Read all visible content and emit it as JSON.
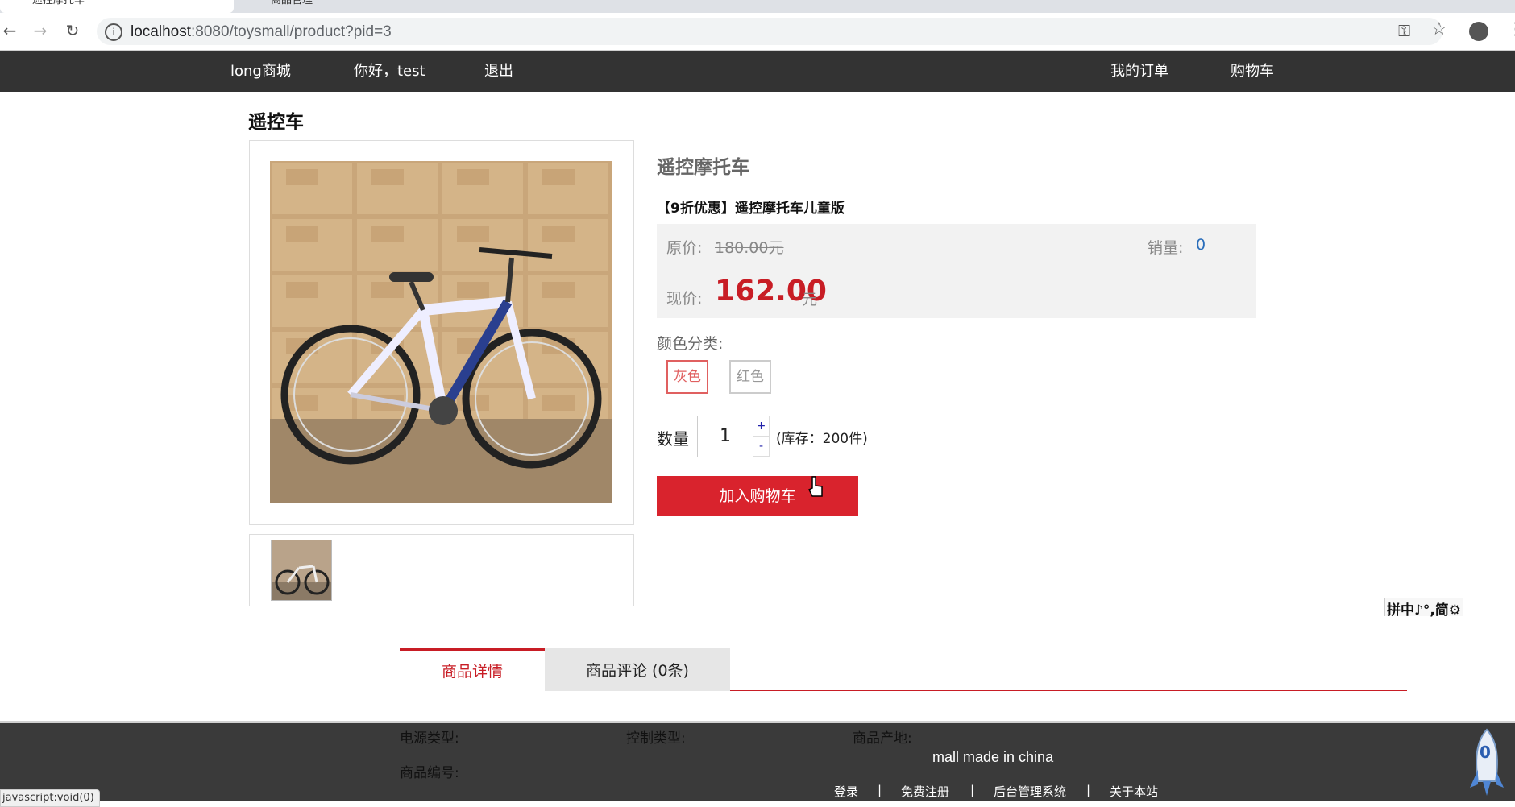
{
  "browser": {
    "tab1_title": "遥控摩托车",
    "tab2_title": "商品管理",
    "url_host": "localhost",
    "url_path": ":8080/toysmall/product?pid=3"
  },
  "header": {
    "brand": "long商城",
    "greeting": "你好，test",
    "logout": "退出",
    "orders": "我的订单",
    "cart": "购物车"
  },
  "category": "遥控车",
  "product": {
    "name": "遥控摩托车",
    "description": "【9折优惠】遥控摩托车儿童版",
    "original_price_label": "原价:",
    "original_price": "180.00元",
    "sales_label": "销量:",
    "sales": "0",
    "now_price_label": "现价:",
    "now_price": "162.00",
    "now_price_unit": "元",
    "color_label": "颜色分类:",
    "colors": [
      "灰色",
      "红色"
    ],
    "quantity_label": "数量",
    "quantity": "1",
    "plus": "+",
    "minus": "-",
    "stock": "(库存：200件)",
    "add_to_cart": "加入购物车"
  },
  "ime": "拼中♪°,简⚙",
  "tabs": {
    "detail": "商品详情",
    "review": "商品评论 (0条)"
  },
  "attributes": {
    "power": "电源类型:",
    "control": "控制类型:",
    "origin": "商品产地:",
    "code": "商品编号:"
  },
  "footer": {
    "tagline": "mall made in china",
    "links": [
      "登录",
      "免费注册",
      "后台管理系统",
      "关于本站"
    ],
    "separator": "|"
  },
  "status_bar": "javascript:void(0)",
  "rocket_badge": "0",
  "colors": {
    "nav_bg": "#333333",
    "accent_red": "#d9232d",
    "price_red": "#c81d25",
    "link_blue": "#2a6ebb"
  }
}
